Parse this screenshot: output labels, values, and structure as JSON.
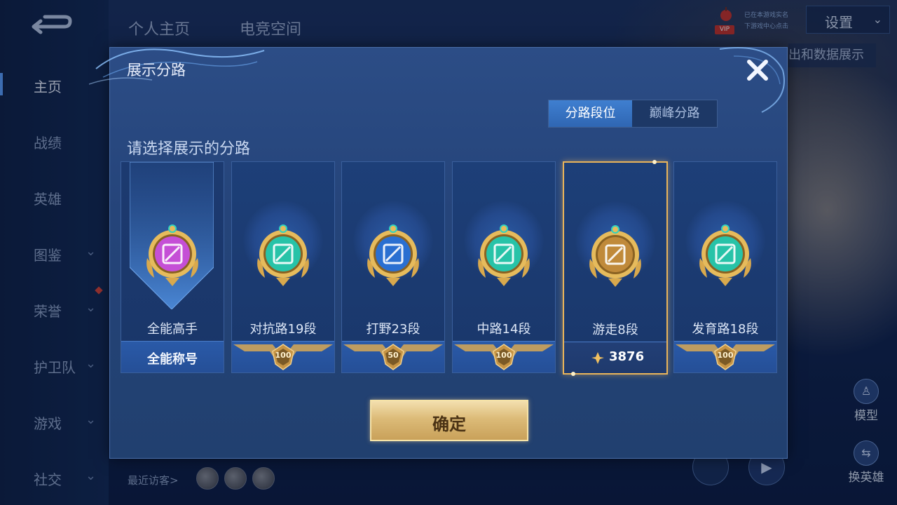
{
  "background": {
    "top_tabs": [
      "个人主页",
      "电竞空间"
    ],
    "sidebar": [
      {
        "label": "主页",
        "chevron": false,
        "active": true
      },
      {
        "label": "战绩",
        "chevron": false
      },
      {
        "label": "英雄",
        "chevron": false
      },
      {
        "label": "图鉴",
        "chevron": true
      },
      {
        "label": "荣誉",
        "chevron": true
      },
      {
        "label": "护卫队",
        "chevron": true
      },
      {
        "label": "游戏",
        "chevron": true
      },
      {
        "label": "社交",
        "chevron": true
      }
    ],
    "vip_badge": "VIP",
    "vip_line1": "已在本游戏实名",
    "vip_line2": "下游戏中心点击",
    "settings_label": "设置",
    "chip_label": "出和数据展示",
    "recent_visitors": "最近访客>",
    "model_label": "模型",
    "switch_hero_label": "换英雄",
    "chevron_glyph": "⌄",
    "play_glyph": "▶"
  },
  "modal": {
    "title": "展示分路",
    "tabs": [
      {
        "label": "分路段位",
        "selected": true
      },
      {
        "label": "巅峰分路",
        "selected": false
      }
    ],
    "prompt": "请选择展示的分路",
    "cards": [
      {
        "name": "全能高手",
        "footer": "全能称号",
        "emblem_color": "#c54fd6",
        "icon": "all-round-emblem"
      },
      {
        "name": "对抗路19段",
        "badge": "100",
        "emblem_color": "#27c3a8",
        "icon": "clash-lane-emblem"
      },
      {
        "name": "打野23段",
        "badge": "50",
        "emblem_color": "#2a6fd1",
        "icon": "jungle-emblem"
      },
      {
        "name": "中路14段",
        "badge": "100",
        "emblem_color": "#27c3a8",
        "icon": "mid-lane-emblem"
      },
      {
        "name": "游走8段",
        "score": "3876",
        "emblem_color": "#c08a3a",
        "icon": "roam-emblem",
        "selected": true
      },
      {
        "name": "发育路18段",
        "badge": "100",
        "emblem_color": "#27c3a8",
        "icon": "farm-lane-emblem"
      }
    ],
    "confirm_label": "确定",
    "close_glyph": "✕"
  },
  "colors": {
    "accent_blue": "#3f7fd0",
    "gold": "#e9b45a",
    "panel": "#25447a"
  }
}
